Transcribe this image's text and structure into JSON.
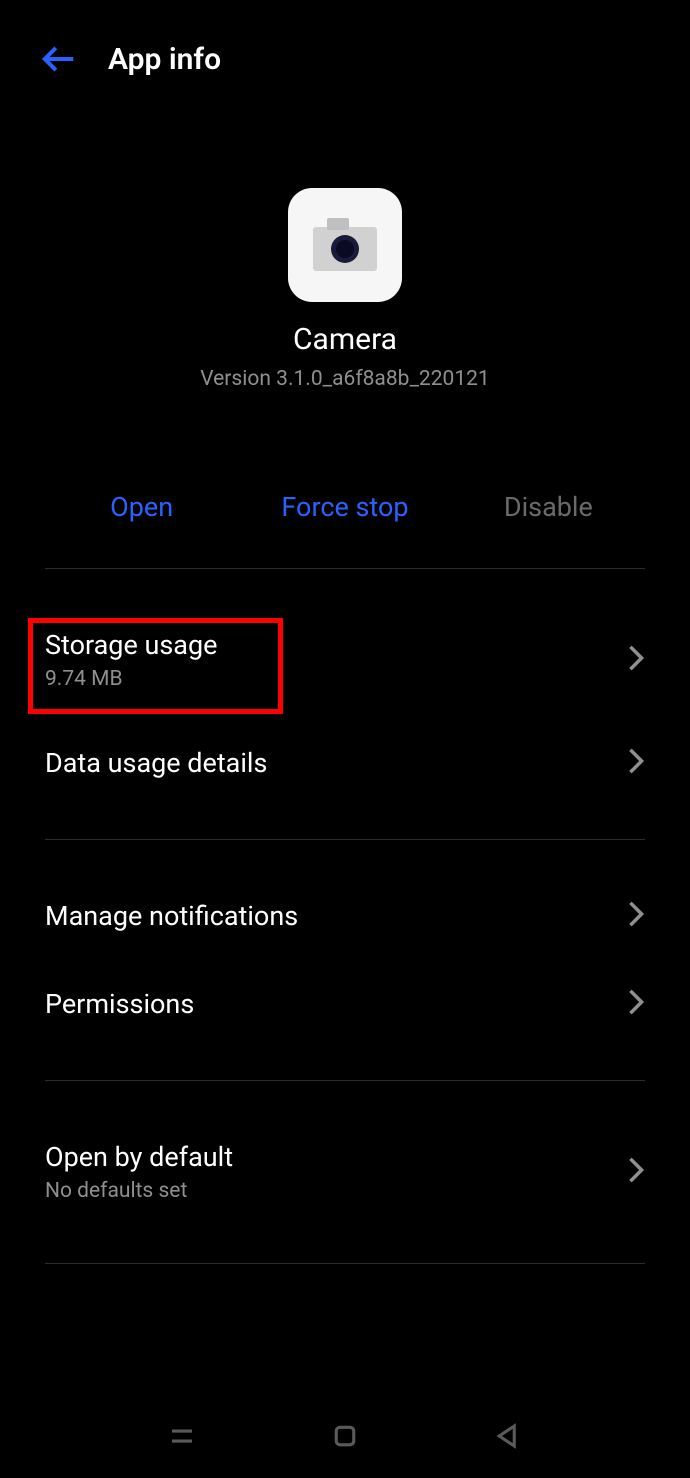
{
  "header": {
    "title": "App info"
  },
  "app": {
    "name": "Camera",
    "version": "Version 3.1.0_a6f8a8b_220121"
  },
  "actions": {
    "open": "Open",
    "force_stop": "Force stop",
    "disable": "Disable"
  },
  "sections": [
    {
      "group": 0,
      "title": "Storage usage",
      "sub": "9.74 MB"
    },
    {
      "group": 0,
      "title": "Data usage details",
      "sub": ""
    },
    {
      "group": 1,
      "title": "Manage notifications",
      "sub": ""
    },
    {
      "group": 1,
      "title": "Permissions",
      "sub": ""
    },
    {
      "group": 2,
      "title": "Open by default",
      "sub": "No defaults set"
    }
  ]
}
